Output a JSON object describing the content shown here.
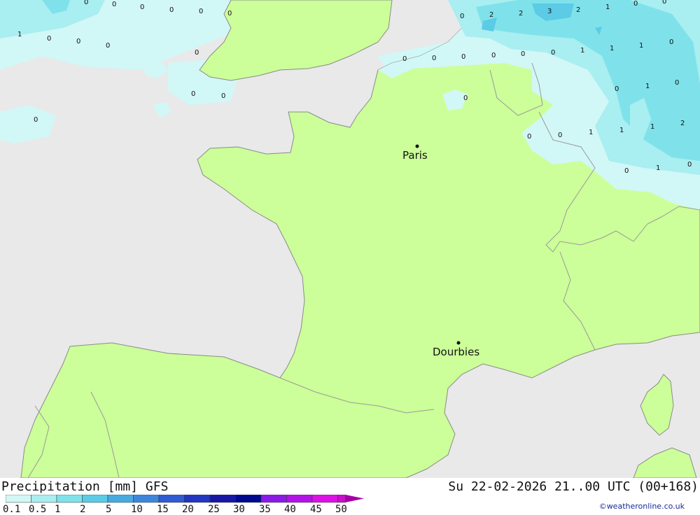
{
  "title": "Precipitation [mm] GFS",
  "timestamp": "Su 22-02-2026 21..00 UTC (00+168)",
  "credit": "©weatheronline.co.uk",
  "cities": [
    "Paris",
    "Dourbies"
  ],
  "colors": {
    "sea": "#e9e9e9",
    "land": "#ccff99",
    "coast": "#8a8a8a",
    "border": "#a0a0a0",
    "precip": [
      "#d2f7f7",
      "#a9eef0",
      "#7fe2ea",
      "#5bcbe6"
    ]
  },
  "legend": {
    "labels": [
      "0.1",
      "0.5",
      "1",
      "2",
      "5",
      "10",
      "15",
      "20",
      "25",
      "30",
      "35",
      "40",
      "45",
      "50"
    ],
    "colors": [
      "#d2f7f7",
      "#a9eef0",
      "#7fe2ea",
      "#5bcbe6",
      "#46abe0",
      "#3d86dc",
      "#2f5bd3",
      "#2236c2",
      "#1718a6",
      "#000a8f",
      "#8a1ae6",
      "#b212e6",
      "#dc10e6",
      "#c80fc8",
      "#a500a5"
    ]
  },
  "values": [
    "0",
    "0",
    "0",
    "0",
    "0",
    "0",
    "0",
    "1",
    "0",
    "0",
    "0",
    "0",
    "0",
    "0",
    "0",
    "0",
    "0",
    "2",
    "2",
    "3",
    "2",
    "1",
    "0",
    "0",
    "0",
    "0",
    "0",
    "0",
    "0",
    "0",
    "1",
    "1",
    "1",
    "0",
    "0",
    "0",
    "1",
    "0",
    "1",
    "1",
    "1",
    "2",
    "0",
    "1",
    "0"
  ]
}
